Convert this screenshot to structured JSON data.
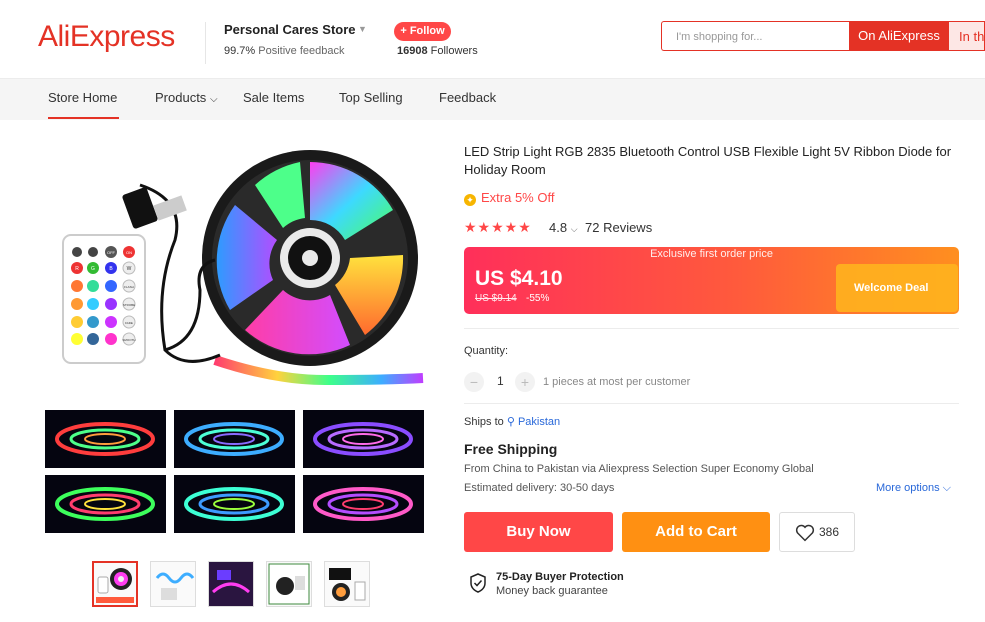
{
  "header": {
    "logo": "AliExpress",
    "store_name": "Personal Cares Store",
    "feedback_pct": "99.7%",
    "feedback_label": "Positive feedback",
    "follow_label": "+ Follow",
    "followers_count": "16908",
    "followers_label": "Followers",
    "search_placeholder": "I'm shopping for...",
    "search_on_label": "On AliExpress",
    "search_in_label": "In th"
  },
  "nav": {
    "items": [
      "Store Home",
      "Products",
      "Sale Items",
      "Top Selling",
      "Feedback"
    ],
    "active": "Store Home"
  },
  "product": {
    "title": "LED Strip Light RGB 2835 Bluetooth Control USB Flexible Light 5V Ribbon Diode for Holiday Room",
    "coupon": "Extra 5% Off",
    "rating": "4.8",
    "reviews": "72 Reviews",
    "banner_label": "Exclusive first order price",
    "price": "US $4.10",
    "original_price": "US $9.14",
    "discount": "-55%",
    "welcome_deal": "Welcome Deal",
    "quantity_label": "Quantity:",
    "quantity_value": "1",
    "quantity_note": "1 pieces at most per customer",
    "ships_to_label": "Ships to",
    "ships_to_location": "Pakistan",
    "shipping_title": "Free Shipping",
    "shipping_from": "From China to Pakistan via Aliexpress Selection Super Economy Global",
    "estimated_delivery": "Estimated delivery: 30-50 days",
    "more_options": "More options",
    "buy_now": "Buy Now",
    "add_to_cart": "Add to Cart",
    "wishlist_count": "386",
    "protection_title": "75-Day Buyer Protection",
    "protection_sub": "Money back guarantee"
  },
  "remote_labels": {
    "off": "OFF",
    "on": "ON",
    "r": "R",
    "g": "G",
    "b": "B",
    "w": "W",
    "flash": "FLASH",
    "strobe": "STROBE",
    "fade": "FADE",
    "smooth": "SMOOTH"
  },
  "colors": {
    "brand_red": "#e43225",
    "price_red": "#ff4747",
    "cart_orange": "#ff9012",
    "link_blue": "#2968d9"
  }
}
